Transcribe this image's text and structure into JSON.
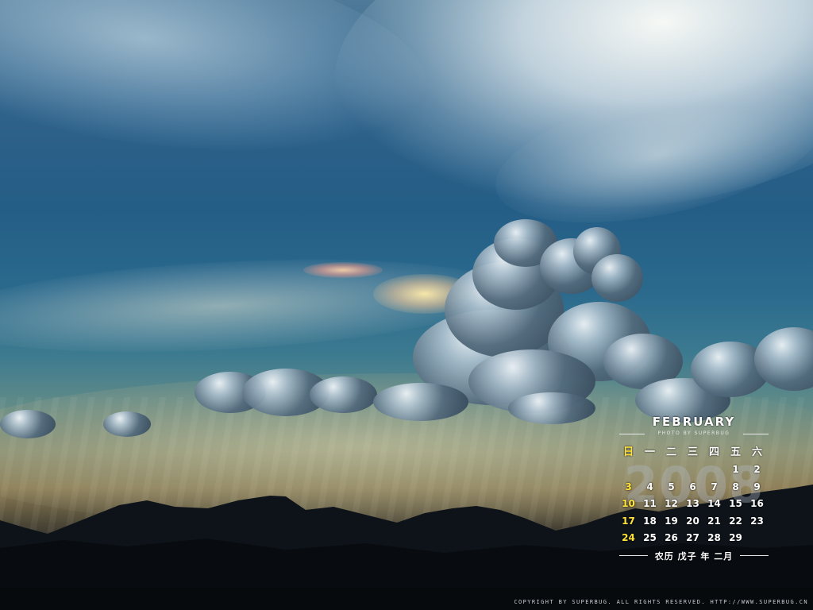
{
  "calendar": {
    "month": "FEBRUARY",
    "photo_credit": "PHOTO BY SUPERBUG",
    "year": "2008",
    "weekdays": [
      {
        "label": "日",
        "sunday": true
      },
      {
        "label": "一",
        "sunday": false
      },
      {
        "label": "二",
        "sunday": false
      },
      {
        "label": "三",
        "sunday": false
      },
      {
        "label": "四",
        "sunday": false
      },
      {
        "label": "五",
        "sunday": false
      },
      {
        "label": "六",
        "sunday": false
      }
    ],
    "days": [
      "",
      "",
      "",
      "",
      "",
      "1",
      "2",
      "3",
      "4",
      "5",
      "6",
      "7",
      "8",
      "9",
      "10",
      "11",
      "12",
      "13",
      "14",
      "15",
      "16",
      "17",
      "18",
      "19",
      "20",
      "21",
      "22",
      "23",
      "24",
      "25",
      "26",
      "27",
      "28",
      "29",
      ""
    ],
    "lunar_note": "农历 戊子 年 二月",
    "colors": {
      "sunday": "#ffe23a",
      "weekday": "#ffffff"
    }
  },
  "copyright": "COPYRIGHT BY SUPERBUG. ALL RIGHTS RESERVED. HTTP://WWW.SUPERBUG.CN"
}
